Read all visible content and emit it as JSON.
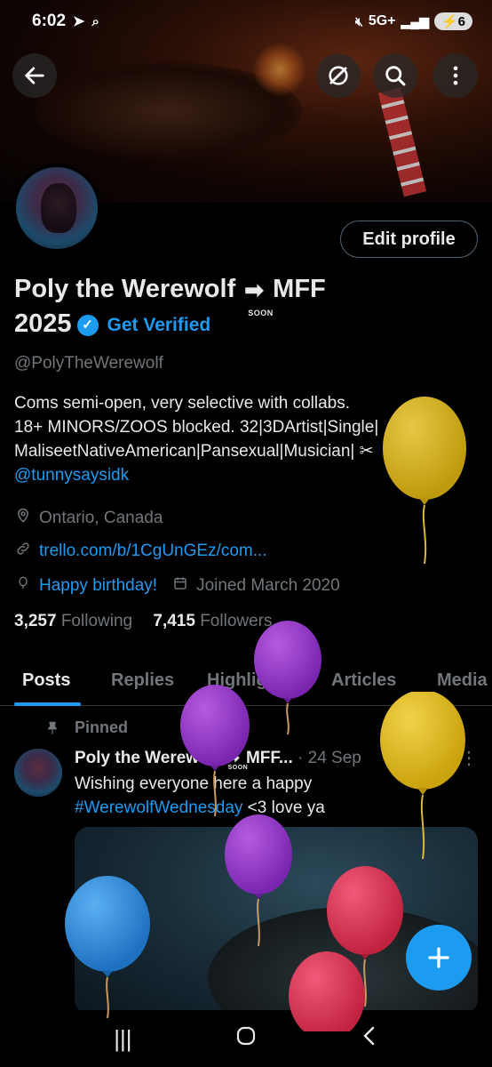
{
  "status": {
    "time": "6:02",
    "network": "5G+",
    "battery": "6"
  },
  "profile": {
    "edit_label": "Edit profile",
    "name_part1": "Poly the Werewolf",
    "soon": "SOON",
    "name_part2": "MFF",
    "name_line2": "2025",
    "get_verified": "Get Verified",
    "handle": "@PolyTheWerewolf",
    "bio_line1": "Coms semi-open, very selective with collabs.",
    "bio_line2": "18+ MINORS/ZOOS blocked. 32|3DArtist|Single|",
    "bio_line3": "MaliseetNativeAmerican|Pansexual|Musician| ✂",
    "bio_mention": "@tunnysaysidk",
    "location": "Ontario, Canada",
    "website": "trello.com/b/1CgUnGEz/com...",
    "birthday": "Happy birthday!",
    "joined": "Joined March 2020",
    "following_count": "3,257",
    "following_label": "Following",
    "followers_count": "7,415",
    "followers_label": "Followers"
  },
  "tabs": [
    "Posts",
    "Replies",
    "Highlights",
    "Articles",
    "Media"
  ],
  "post": {
    "pinned_label": "Pinned",
    "author": "Poly the Werewolf",
    "soon": "SOON",
    "author_tail": "MFF...",
    "date": "· 24 Sep",
    "text_line1": "Wishing everyone here a happy",
    "hashtag": "#WerewolfWednesday",
    "text_tail": " <3 love ya"
  },
  "icons": {
    "back": "arrow-left-icon",
    "grok": "grok-icon",
    "search": "search-icon",
    "more": "more-vertical-icon",
    "verified": "verified-badge-icon",
    "location": "location-pin-icon",
    "link": "link-icon",
    "birthday": "balloon-icon",
    "calendar": "calendar-icon",
    "pin": "pin-icon",
    "compose": "plus-icon"
  },
  "colors": {
    "accent": "#1d9bf0",
    "muted": "#71767b",
    "text": "#e7e9ea",
    "background": "#000000"
  }
}
